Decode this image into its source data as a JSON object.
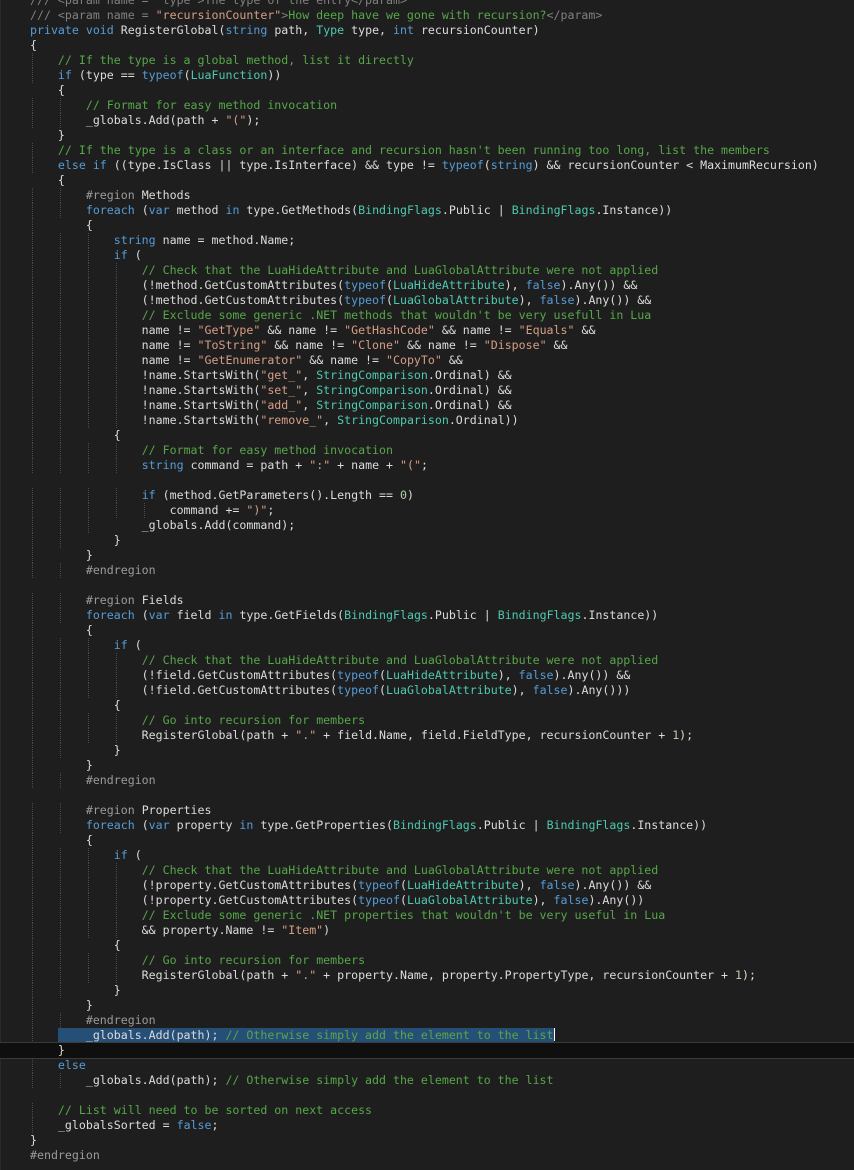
{
  "editor": {
    "language": "C#",
    "theme": {
      "background": "#1e1e1e",
      "plain": "#dcdcdc",
      "keyword": "#569cd6",
      "type": "#4ec9b0",
      "string": "#d69d85",
      "comment": "#57a64a",
      "doc_tag": "#808080",
      "doc_text": "#57a64a",
      "number": "#b5cea8",
      "preprocessor": "#9b9b9b",
      "selection": "#264f78"
    },
    "lines": [
      [
        [
          "d",
          "/// <param name = \"type\">The type of the entry</param>"
        ]
      ],
      [
        [
          "d",
          "/// <param name = "
        ],
        [
          "s",
          "\"recursionCounter\""
        ],
        [
          "d",
          ">"
        ],
        [
          "c",
          "How deep have we gone with recursion?"
        ],
        [
          "d",
          "</param>"
        ]
      ],
      [
        [
          "k",
          "private "
        ],
        [
          "k",
          "void "
        ],
        [
          "p",
          "RegisterGlobal("
        ],
        [
          "k",
          "string "
        ],
        [
          "p",
          "path, "
        ],
        [
          "t",
          "Type "
        ],
        [
          "p",
          "type, "
        ],
        [
          "k",
          "int "
        ],
        [
          "p",
          "recursionCounter)"
        ]
      ],
      [
        [
          "p",
          "{"
        ]
      ],
      [
        [
          "p",
          "    "
        ],
        [
          "c",
          "// If the type is a global method, list it directly"
        ]
      ],
      [
        [
          "p",
          "    "
        ],
        [
          "k",
          "if "
        ],
        [
          "p",
          "(type == "
        ],
        [
          "k",
          "typeof"
        ],
        [
          "p",
          "("
        ],
        [
          "t",
          "LuaFunction"
        ],
        [
          "p",
          "))"
        ]
      ],
      [
        [
          "p",
          "    {"
        ]
      ],
      [
        [
          "p",
          "        "
        ],
        [
          "c",
          "// Format for easy method invocation"
        ]
      ],
      [
        [
          "p",
          "        _globals.Add(path + "
        ],
        [
          "s",
          "\"(\""
        ],
        [
          "p",
          ");"
        ]
      ],
      [
        [
          "p",
          "    }"
        ]
      ],
      [
        [
          "p",
          "    "
        ],
        [
          "c",
          "// If the type is a class or an interface and recursion hasn't been running too long, list the members"
        ]
      ],
      [
        [
          "p",
          "    "
        ],
        [
          "k",
          "else if "
        ],
        [
          "p",
          "((type.IsClass || type.IsInterface) && type != "
        ],
        [
          "k",
          "typeof"
        ],
        [
          "p",
          "("
        ],
        [
          "k",
          "string"
        ],
        [
          "p",
          ") && recursionCounter < MaximumRecursion)"
        ]
      ],
      [
        [
          "p",
          "    {"
        ]
      ],
      [
        [
          "p",
          "        "
        ],
        [
          "r",
          "#region "
        ],
        [
          "p",
          "Methods"
        ]
      ],
      [
        [
          "p",
          "        "
        ],
        [
          "k",
          "foreach "
        ],
        [
          "p",
          "("
        ],
        [
          "k",
          "var "
        ],
        [
          "p",
          "method "
        ],
        [
          "k",
          "in "
        ],
        [
          "p",
          "type.GetMethods("
        ],
        [
          "t",
          "BindingFlags"
        ],
        [
          "p",
          ".Public | "
        ],
        [
          "t",
          "BindingFlags"
        ],
        [
          "p",
          ".Instance))"
        ]
      ],
      [
        [
          "p",
          "        {"
        ]
      ],
      [
        [
          "p",
          "            "
        ],
        [
          "k",
          "string "
        ],
        [
          "p",
          "name = method.Name;"
        ]
      ],
      [
        [
          "p",
          "            "
        ],
        [
          "k",
          "if "
        ],
        [
          "p",
          "("
        ]
      ],
      [
        [
          "p",
          "                "
        ],
        [
          "c",
          "// Check that the LuaHideAttribute and LuaGlobalAttribute were not applied"
        ]
      ],
      [
        [
          "p",
          "                (!method.GetCustomAttributes("
        ],
        [
          "k",
          "typeof"
        ],
        [
          "p",
          "("
        ],
        [
          "t",
          "LuaHideAttribute"
        ],
        [
          "p",
          "), "
        ],
        [
          "k",
          "false"
        ],
        [
          "p",
          ").Any()) &&"
        ]
      ],
      [
        [
          "p",
          "                (!method.GetCustomAttributes("
        ],
        [
          "k",
          "typeof"
        ],
        [
          "p",
          "("
        ],
        [
          "t",
          "LuaGlobalAttribute"
        ],
        [
          "p",
          "), "
        ],
        [
          "k",
          "false"
        ],
        [
          "p",
          ").Any()) &&"
        ]
      ],
      [
        [
          "p",
          "                "
        ],
        [
          "c",
          "// Exclude some generic .NET methods that wouldn't be very usefull in Lua"
        ]
      ],
      [
        [
          "p",
          "                name != "
        ],
        [
          "s",
          "\"GetType\""
        ],
        [
          "p",
          " && name != "
        ],
        [
          "s",
          "\"GetHashCode\""
        ],
        [
          "p",
          " && name != "
        ],
        [
          "s",
          "\"Equals\""
        ],
        [
          "p",
          " &&"
        ]
      ],
      [
        [
          "p",
          "                name != "
        ],
        [
          "s",
          "\"ToString\""
        ],
        [
          "p",
          " && name != "
        ],
        [
          "s",
          "\"Clone\""
        ],
        [
          "p",
          " && name != "
        ],
        [
          "s",
          "\"Dispose\""
        ],
        [
          "p",
          " &&"
        ]
      ],
      [
        [
          "p",
          "                name != "
        ],
        [
          "s",
          "\"GetEnumerator\""
        ],
        [
          "p",
          " && name != "
        ],
        [
          "s",
          "\"CopyTo\""
        ],
        [
          "p",
          " &&"
        ]
      ],
      [
        [
          "p",
          "                !name.StartsWith("
        ],
        [
          "s",
          "\"get_\""
        ],
        [
          "p",
          ", "
        ],
        [
          "t",
          "StringComparison"
        ],
        [
          "p",
          ".Ordinal) &&"
        ]
      ],
      [
        [
          "p",
          "                !name.StartsWith("
        ],
        [
          "s",
          "\"set_\""
        ],
        [
          "p",
          ", "
        ],
        [
          "t",
          "StringComparison"
        ],
        [
          "p",
          ".Ordinal) &&"
        ]
      ],
      [
        [
          "p",
          "                !name.StartsWith("
        ],
        [
          "s",
          "\"add_\""
        ],
        [
          "p",
          ", "
        ],
        [
          "t",
          "StringComparison"
        ],
        [
          "p",
          ".Ordinal) &&"
        ]
      ],
      [
        [
          "p",
          "                !name.StartsWith("
        ],
        [
          "s",
          "\"remove_\""
        ],
        [
          "p",
          ", "
        ],
        [
          "t",
          "StringComparison"
        ],
        [
          "p",
          ".Ordinal))"
        ]
      ],
      [
        [
          "p",
          "            {"
        ]
      ],
      [
        [
          "p",
          "                "
        ],
        [
          "c",
          "// Format for easy method invocation"
        ]
      ],
      [
        [
          "p",
          "                "
        ],
        [
          "k",
          "string "
        ],
        [
          "p",
          "command = path + "
        ],
        [
          "s",
          "\":\""
        ],
        [
          "p",
          " + name + "
        ],
        [
          "s",
          "\"(\""
        ],
        [
          "p",
          ";"
        ]
      ],
      [],
      [
        [
          "p",
          "                "
        ],
        [
          "k",
          "if "
        ],
        [
          "p",
          "(method.GetParameters().Length == "
        ],
        [
          "n",
          "0"
        ],
        [
          "p",
          ")"
        ]
      ],
      [
        [
          "p",
          "                    command += "
        ],
        [
          "s",
          "\")\""
        ],
        [
          "p",
          ";"
        ]
      ],
      [
        [
          "p",
          "                _globals.Add(command);"
        ]
      ],
      [
        [
          "p",
          "            }"
        ]
      ],
      [
        [
          "p",
          "        }"
        ]
      ],
      [
        [
          "p",
          "        "
        ],
        [
          "r",
          "#endregion"
        ]
      ],
      [],
      [
        [
          "p",
          "        "
        ],
        [
          "r",
          "#region "
        ],
        [
          "p",
          "Fields"
        ]
      ],
      [
        [
          "p",
          "        "
        ],
        [
          "k",
          "foreach "
        ],
        [
          "p",
          "("
        ],
        [
          "k",
          "var "
        ],
        [
          "p",
          "field "
        ],
        [
          "k",
          "in "
        ],
        [
          "p",
          "type.GetFields("
        ],
        [
          "t",
          "BindingFlags"
        ],
        [
          "p",
          ".Public | "
        ],
        [
          "t",
          "BindingFlags"
        ],
        [
          "p",
          ".Instance))"
        ]
      ],
      [
        [
          "p",
          "        {"
        ]
      ],
      [
        [
          "p",
          "            "
        ],
        [
          "k",
          "if "
        ],
        [
          "p",
          "("
        ]
      ],
      [
        [
          "p",
          "                "
        ],
        [
          "c",
          "// Check that the LuaHideAttribute and LuaGlobalAttribute were not applied"
        ]
      ],
      [
        [
          "p",
          "                (!field.GetCustomAttributes("
        ],
        [
          "k",
          "typeof"
        ],
        [
          "p",
          "("
        ],
        [
          "t",
          "LuaHideAttribute"
        ],
        [
          "p",
          "), "
        ],
        [
          "k",
          "false"
        ],
        [
          "p",
          ").Any()) &&"
        ]
      ],
      [
        [
          "p",
          "                (!field.GetCustomAttributes("
        ],
        [
          "k",
          "typeof"
        ],
        [
          "p",
          "("
        ],
        [
          "t",
          "LuaGlobalAttribute"
        ],
        [
          "p",
          "), "
        ],
        [
          "k",
          "false"
        ],
        [
          "p",
          ").Any()))"
        ]
      ],
      [
        [
          "p",
          "            {"
        ]
      ],
      [
        [
          "p",
          "                "
        ],
        [
          "c",
          "// Go into recursion for members"
        ]
      ],
      [
        [
          "p",
          "                RegisterGlobal(path + "
        ],
        [
          "s",
          "\".\""
        ],
        [
          "p",
          " + field.Name, field.FieldType, recursionCounter + "
        ],
        [
          "n",
          "1"
        ],
        [
          "p",
          ");"
        ]
      ],
      [
        [
          "p",
          "            }"
        ]
      ],
      [
        [
          "p",
          "        }"
        ]
      ],
      [
        [
          "p",
          "        "
        ],
        [
          "r",
          "#endregion"
        ]
      ],
      [],
      [
        [
          "p",
          "        "
        ],
        [
          "r",
          "#region "
        ],
        [
          "p",
          "Properties"
        ]
      ],
      [
        [
          "p",
          "        "
        ],
        [
          "k",
          "foreach "
        ],
        [
          "p",
          "("
        ],
        [
          "k",
          "var "
        ],
        [
          "p",
          "property "
        ],
        [
          "k",
          "in "
        ],
        [
          "p",
          "type.GetProperties("
        ],
        [
          "t",
          "BindingFlags"
        ],
        [
          "p",
          ".Public | "
        ],
        [
          "t",
          "BindingFlags"
        ],
        [
          "p",
          ".Instance))"
        ]
      ],
      [
        [
          "p",
          "        {"
        ]
      ],
      [
        [
          "p",
          "            "
        ],
        [
          "k",
          "if "
        ],
        [
          "p",
          "("
        ]
      ],
      [
        [
          "p",
          "                "
        ],
        [
          "c",
          "// Check that the LuaHideAttribute and LuaGlobalAttribute were not applied"
        ]
      ],
      [
        [
          "p",
          "                (!property.GetCustomAttributes("
        ],
        [
          "k",
          "typeof"
        ],
        [
          "p",
          "("
        ],
        [
          "t",
          "LuaHideAttribute"
        ],
        [
          "p",
          "), "
        ],
        [
          "k",
          "false"
        ],
        [
          "p",
          ").Any()) &&"
        ]
      ],
      [
        [
          "p",
          "                (!property.GetCustomAttributes("
        ],
        [
          "k",
          "typeof"
        ],
        [
          "p",
          "("
        ],
        [
          "t",
          "LuaGlobalAttribute"
        ],
        [
          "p",
          "), "
        ],
        [
          "k",
          "false"
        ],
        [
          "p",
          ").Any())"
        ]
      ],
      [
        [
          "p",
          "                "
        ],
        [
          "c",
          "// Exclude some generic .NET properties that wouldn't be very useful in Lua"
        ]
      ],
      [
        [
          "p",
          "                && property.Name != "
        ],
        [
          "s",
          "\"Item\""
        ],
        [
          "p",
          ")"
        ]
      ],
      [
        [
          "p",
          "            {"
        ]
      ],
      [
        [
          "p",
          "                "
        ],
        [
          "c",
          "// Go into recursion for members"
        ]
      ],
      [
        [
          "p",
          "                RegisterGlobal(path + "
        ],
        [
          "s",
          "\".\""
        ],
        [
          "p",
          " + property.Name, property.PropertyType, recursionCounter + "
        ],
        [
          "n",
          "1"
        ],
        [
          "p",
          ");"
        ]
      ],
      [
        [
          "p",
          "            }"
        ]
      ],
      [
        [
          "p",
          "        }"
        ]
      ],
      [
        [
          "p",
          "        "
        ],
        [
          "r",
          "#endregion"
        ]
      ],
      [
        [
          "p",
          "    "
        ],
        [
          "ps",
          "    _globals.Add(path); "
        ],
        [
          "cs",
          "// Otherwise simply add the element to the list"
        ],
        [
          "caret",
          ""
        ]
      ],
      [
        [
          "p",
          "    }"
        ]
      ],
      [
        [
          "p",
          "    "
        ],
        [
          "k",
          "else"
        ]
      ],
      [
        [
          "p",
          "        _globals.Add(path); "
        ],
        [
          "c",
          "// Otherwise simply add the element to the list"
        ]
      ],
      [],
      [
        [
          "p",
          "    "
        ],
        [
          "c",
          "// List will need to be sorted on next access"
        ]
      ],
      [
        [
          "p",
          "    _globalsSorted = "
        ],
        [
          "k",
          "false"
        ],
        [
          "p",
          ";"
        ]
      ],
      [
        [
          "p",
          "}"
        ]
      ],
      [
        [
          "r",
          "#endregion"
        ]
      ]
    ],
    "current_line": 70
  }
}
